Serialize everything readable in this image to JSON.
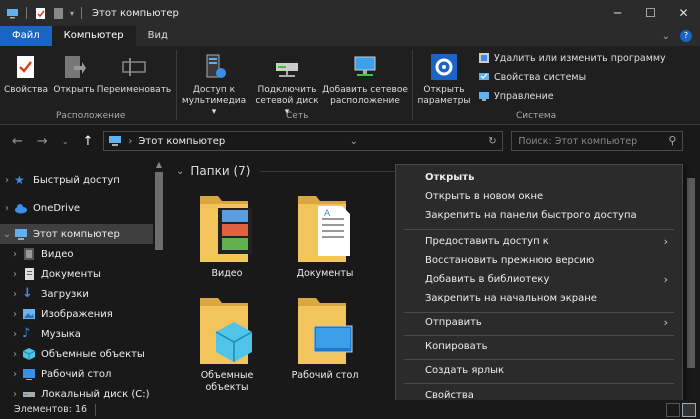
{
  "window": {
    "title": "Этот компьютер"
  },
  "tabs": [
    "Файл",
    "Компьютер",
    "Вид"
  ],
  "ribbon": {
    "location_group": {
      "label": "Расположение",
      "buttons": [
        "Свойства",
        "Открыть",
        "Переименовать"
      ]
    },
    "network_group": {
      "label": "Сеть",
      "buttons": [
        {
          "line1": "Доступ к",
          "line2": "мультимедиа ▾"
        },
        {
          "line1": "Подключить",
          "line2": "сетевой диск ▾"
        },
        {
          "line1": "Добавить сетевое",
          "line2": "расположение"
        }
      ]
    },
    "system_group": {
      "label": "Система",
      "big_button": {
        "line1": "Открыть",
        "line2": "параметры"
      },
      "small_buttons": [
        "Удалить или изменить программу",
        "Свойства системы",
        "Управление"
      ]
    }
  },
  "address": {
    "path": "Этот компьютер",
    "search_placeholder": "Поиск: Этот компьютер"
  },
  "nav": {
    "items": [
      {
        "label": "Быстрый доступ",
        "icon": "star-icon",
        "color": "#3c8fe8"
      },
      {
        "label": "OneDrive",
        "icon": "cloud-icon",
        "color": "#3c8fe8"
      },
      {
        "label": "Этот компьютер",
        "icon": "computer-icon",
        "color": "#5fb0f0"
      },
      {
        "label": "Видео",
        "icon": "video-icon",
        "color": "#888"
      },
      {
        "label": "Документы",
        "icon": "documents-icon",
        "color": "#ccc"
      },
      {
        "label": "Загрузки",
        "icon": "download-icon",
        "color": "#3c8fe8"
      },
      {
        "label": "Изображения",
        "icon": "pictures-icon",
        "color": "#6ab4f0"
      },
      {
        "label": "Музыка",
        "icon": "music-icon",
        "color": "#3c8fe8"
      },
      {
        "label": "Объемные объекты",
        "icon": "3d-objects-icon",
        "color": "#4fc3e8"
      },
      {
        "label": "Рабочий стол",
        "icon": "desktop-icon",
        "color": "#3c8fe8"
      },
      {
        "label": "Локальный диск (C:)",
        "icon": "drive-icon",
        "color": "#aaa"
      }
    ]
  },
  "content": {
    "group_header": "Папки (7)",
    "folders": [
      "Видео",
      "Документы",
      "Объемные объекты",
      "Рабочий стол"
    ]
  },
  "context_menu": {
    "items": [
      {
        "label": "Открыть",
        "bold": true,
        "submenu": false
      },
      {
        "label": "Открыть в новом окне",
        "bold": false,
        "submenu": false
      },
      {
        "label": "Закрепить на панели быстрого доступа",
        "bold": false,
        "submenu": false
      },
      {
        "label": "Предоставить доступ к",
        "bold": false,
        "submenu": true
      },
      {
        "label": "Восстановить прежнюю версию",
        "bold": false,
        "submenu": false
      },
      {
        "label": "Добавить в библиотеку",
        "bold": false,
        "submenu": true
      },
      {
        "label": "Закрепить на начальном экране",
        "bold": false,
        "submenu": false
      },
      {
        "label": "Отправить",
        "bold": false,
        "submenu": true
      },
      {
        "label": "Копировать",
        "bold": false,
        "submenu": false
      },
      {
        "label": "Создать ярлык",
        "bold": false,
        "submenu": false
      },
      {
        "label": "Свойства",
        "bold": false,
        "submenu": false
      }
    ]
  },
  "status": {
    "items_count": "Элементов: 16"
  },
  "colors": {
    "accent": "#1a64c6",
    "folder": "#f2c45c",
    "background": "#191919"
  }
}
